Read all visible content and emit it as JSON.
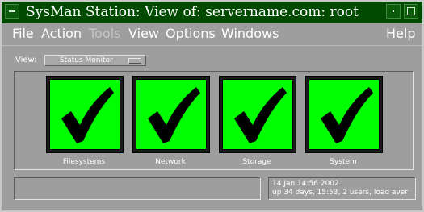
{
  "window": {
    "title": "SysMan Station: View of: servername.com: root"
  },
  "menu": {
    "items": [
      {
        "label": "File",
        "enabled": true
      },
      {
        "label": "Action",
        "enabled": true
      },
      {
        "label": "Tools",
        "enabled": false
      },
      {
        "label": "View",
        "enabled": true
      },
      {
        "label": "Options",
        "enabled": true
      },
      {
        "label": "Windows",
        "enabled": true
      }
    ],
    "help_label": "Help"
  },
  "view_selector": {
    "label": "View:",
    "selected": "Status Monitor"
  },
  "monitors": [
    {
      "label": "Filesystems",
      "status": "ok",
      "icon": "checkmark-icon"
    },
    {
      "label": "Network",
      "status": "ok",
      "icon": "checkmark-icon"
    },
    {
      "label": "Storage",
      "status": "ok",
      "icon": "checkmark-icon"
    },
    {
      "label": "System",
      "status": "ok",
      "icon": "checkmark-icon"
    }
  ],
  "status_bar": {
    "message": "",
    "timestamp": "14 Jan 14:56 2002",
    "uptime": "up 34 days, 15:53,  2 users,  load aver"
  },
  "colors": {
    "titlebar": "#004a00",
    "window_bg": "#9e9e9e",
    "status_ok": "#00ff00"
  }
}
